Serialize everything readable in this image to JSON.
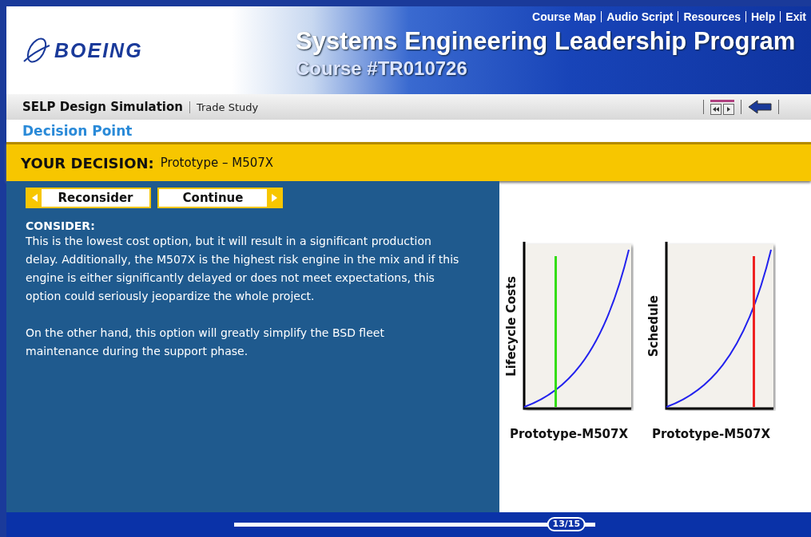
{
  "header": {
    "logo_text": "BOEING",
    "links": [
      "Course Map",
      "Audio Script",
      "Resources",
      "Help",
      "Exit"
    ],
    "title": "Systems Engineering Leadership Program",
    "course": "Course #TR010726"
  },
  "toolbar": {
    "module": "SELP Design Simulation",
    "section": "Trade Study"
  },
  "page_title": "Decision Point",
  "decision": {
    "label": "YOUR DECISION:",
    "value": "Prototype – M507X"
  },
  "buttons": [
    {
      "label": "Reconsider",
      "kind": "back"
    },
    {
      "label": "Continue",
      "kind": "forward"
    }
  ],
  "consider": {
    "heading": "CONSIDER:",
    "paragraphs": [
      "This is the lowest cost option, but it will result in a significant production delay. Additionally, the M507X is the highest risk engine in the mix and if this engine is either significantly delayed or does not meet expectations, this option could seriously jeopardize the whole project.",
      "On the other hand, this option will greatly simplify the BSD fleet maintenance during the support phase."
    ]
  },
  "charts": [
    {
      "ylabel": "Lifecycle Costs",
      "xlabel": "Prototype-M507X",
      "color": "#33dd11"
    },
    {
      "ylabel": "Schedule",
      "xlabel": "Prototype-M507X",
      "color": "#ee2222"
    }
  ],
  "progress": {
    "label": "13/15",
    "level": 0.92
  }
}
